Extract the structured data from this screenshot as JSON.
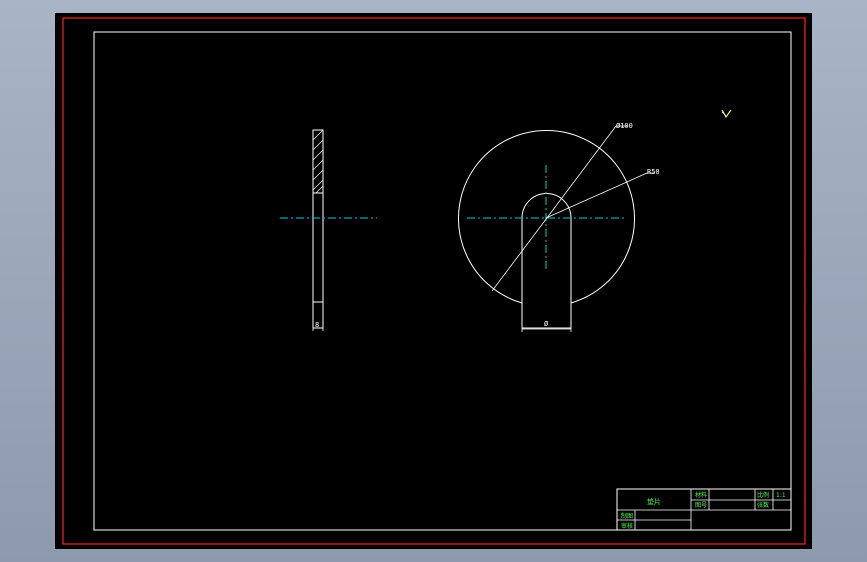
{
  "colors": {
    "background": "#000000",
    "outer_frame": "#ff2020",
    "geometry": "#ffffff",
    "centerline": "#00d0d0",
    "title_block_text": "#40ff40"
  },
  "drawing": {
    "side_view_dim": "8",
    "front_view_dim_top": "Ø100",
    "front_view_dim_right": "R50",
    "front_view_dim_bottom": "Ø"
  },
  "title_block": {
    "part_name": "垫片",
    "material_label": "材料",
    "scale_label": "比例",
    "scale_value": "1:1",
    "drawing_no_label": "图号",
    "sheet_label": "张数",
    "drafter_label": "制图",
    "reviewer_label": "审核"
  },
  "icons": {
    "ucs": "ucs-icon"
  }
}
